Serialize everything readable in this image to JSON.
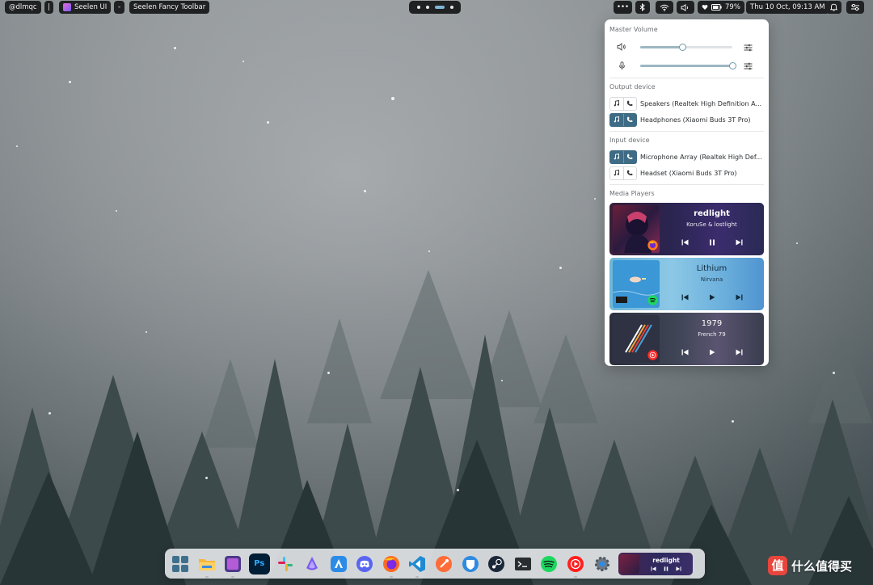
{
  "topbar": {
    "user": "@dlmqc",
    "separator": "|",
    "app_name": "Seelen UI",
    "dash": "-",
    "window_title": "Seelen Fancy Toolbar",
    "overflow": "•••",
    "battery": "79%",
    "datetime": "Thu 10 Oct, 09:13 AM",
    "workspaces_active_index": 2
  },
  "audio_panel": {
    "master_volume_title": "Master Volume",
    "output_volume_level": 0.46,
    "input_volume_level": 1.0,
    "output_device_title": "Output device",
    "output_devices": [
      {
        "name": "Speakers (Realtek High Definition A...",
        "active": false
      },
      {
        "name": "Headphones (Xiaomi Buds 3T Pro)",
        "active": true
      }
    ],
    "input_device_title": "Input device",
    "input_devices": [
      {
        "name": "Microphone Array (Realtek High Def...",
        "active": true
      },
      {
        "name": "Headset (Xiaomi Buds 3T Pro)",
        "active": false
      }
    ],
    "media_players_title": "Media Players",
    "players": [
      {
        "title": "redlight",
        "artist": "KoruSe & lostlight",
        "app": "firefox-icon",
        "state": "playing"
      },
      {
        "title": "Lithium",
        "artist": "Nirvana",
        "app": "spotify-icon",
        "state": "paused"
      },
      {
        "title": "1979",
        "artist": "French 79",
        "app": "youtube-music-icon",
        "state": "paused"
      }
    ]
  },
  "dock": {
    "items": [
      "windows-start-icon",
      "file-explorer-icon",
      "seelen-icon",
      "photoshop-icon",
      "slack-icon",
      "proton-vpn-icon",
      "altstore-icon",
      "discord-icon",
      "firefox-icon",
      "vscode-icon",
      "postman-icon",
      "bitwarden-icon",
      "steam-icon",
      "terminal-icon",
      "spotify-icon",
      "youtube-music-icon",
      "settings-icon"
    ],
    "photoshop_label": "Ps",
    "media_title": "redlight"
  },
  "watermark": {
    "text": "什么值得买",
    "logo_char": "值"
  },
  "colors": {
    "accent": "#3e6b85",
    "slider_fill": "#9cb7c2",
    "bar_bg": "#1f2123"
  }
}
